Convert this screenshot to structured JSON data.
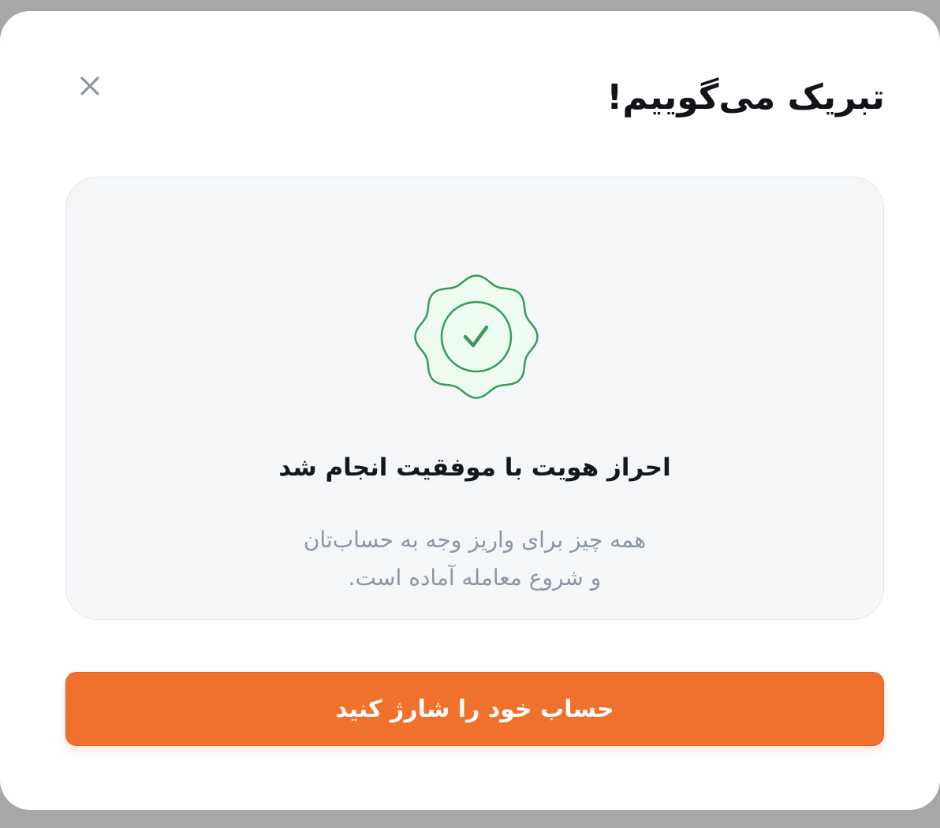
{
  "modal": {
    "title": "تبریک می‌گوییم!",
    "close_icon": "close-icon"
  },
  "card": {
    "badge_icon": "verified-badge-check-icon",
    "title": "احراز هویت با موفقیت انجام شد",
    "description_line1": "همه چیز برای واریز وجه به حساب‌تان",
    "description_line2": "و شروع معامله آماده است."
  },
  "cta": {
    "label": "حساب خود را شارژ کنید"
  },
  "colors": {
    "backdrop": "#a6a7a7",
    "accent": "#f0702e",
    "success": "#3a9a5a",
    "success_fill": "#edfbf1",
    "muted_text": "#8b96a5",
    "card_background": "#f4f6f8"
  }
}
